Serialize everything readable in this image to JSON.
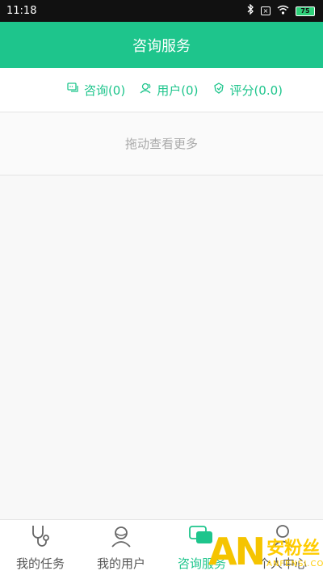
{
  "status_bar": {
    "time": "11:18",
    "battery": "75",
    "icons": [
      "bluetooth-icon",
      "sim-icon",
      "wifi-icon",
      "battery-icon"
    ]
  },
  "header": {
    "title": "咨询服务"
  },
  "stats": [
    {
      "icon": "chat-icon",
      "label": "咨询(0)"
    },
    {
      "icon": "users-icon",
      "label": "用户(0)"
    },
    {
      "icon": "rating-icon",
      "label": "评分(0.0)"
    }
  ],
  "pull_hint": "拖动查看更多",
  "bottom_nav": {
    "items": [
      {
        "icon": "stethoscope-icon",
        "label": "我的任务",
        "active": false
      },
      {
        "icon": "user-group-icon",
        "label": "我的用户",
        "active": false
      },
      {
        "icon": "chat-bubble-icon",
        "label": "咨询服务",
        "active": true
      },
      {
        "icon": "person-icon",
        "label": "个人中心",
        "active": false
      }
    ]
  },
  "watermark": {
    "logo": "AN",
    "cn": "安粉丝",
    "en": "ANFENSI.COM"
  },
  "colors": {
    "accent": "#1ec58c",
    "status_bar_bg": "#111111",
    "watermark": "#f5c400"
  }
}
